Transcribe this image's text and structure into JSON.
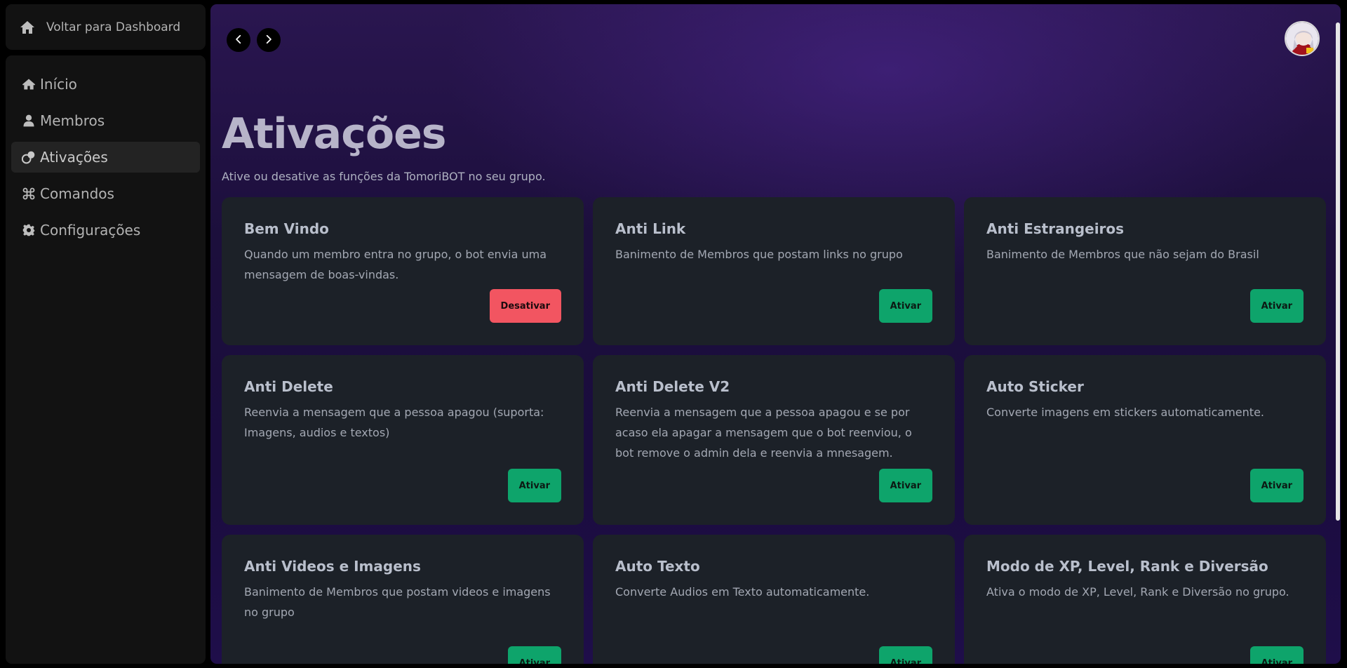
{
  "sidebar": {
    "back_label": "Voltar para Dashboard",
    "items": [
      {
        "label": "Início",
        "icon": "home-icon",
        "active": false
      },
      {
        "label": "Membros",
        "icon": "user-icon",
        "active": false
      },
      {
        "label": "Ativações",
        "icon": "toggle-icon",
        "active": true
      },
      {
        "label": "Comandos",
        "icon": "command-icon",
        "active": false
      },
      {
        "label": "Configurações",
        "icon": "gear-icon",
        "active": false
      }
    ]
  },
  "header": {
    "prev_icon": "chevron-left-icon",
    "next_icon": "chevron-right-icon",
    "avatar_icon": "avatar"
  },
  "page": {
    "title": "Ativações",
    "subtitle": "Ative ou desative as funções da TomoriBOT no seu grupo."
  },
  "cards": [
    {
      "title": "Bem Vindo",
      "description": "Quando um membro entra no grupo, o bot envia uma mensagem de boas-vindas.",
      "button": "Desativar",
      "state": "on"
    },
    {
      "title": "Anti Link",
      "description": "Banimento de Membros que postam links no grupo",
      "button": "Ativar",
      "state": "off"
    },
    {
      "title": "Anti Estrangeiros",
      "description": "Banimento de Membros que não sejam do Brasil",
      "button": "Ativar",
      "state": "off"
    },
    {
      "title": "Anti Delete",
      "description": "Reenvia a mensagem que a pessoa apagou (suporta: Imagens, audios e textos)",
      "button": "Ativar",
      "state": "off"
    },
    {
      "title": "Anti Delete V2",
      "description": "Reenvia a mensagem que a pessoa apagou e se por acaso ela apagar a mensagem que o bot reenviou, o bot remove o admin dela e reenvia a mnesagem.",
      "button": "Ativar",
      "state": "off"
    },
    {
      "title": "Auto Sticker",
      "description": "Converte imagens em stickers automaticamente.",
      "button": "Ativar",
      "state": "off"
    },
    {
      "title": "Anti Videos e Imagens",
      "description": "Banimento de Membros que postam videos e imagens no grupo",
      "button": "Ativar",
      "state": "off"
    },
    {
      "title": "Auto Texto",
      "description": "Converte Audios em Texto automaticamente.",
      "button": "Ativar",
      "state": "off"
    },
    {
      "title": "Modo de XP, Level, Rank e Diversão",
      "description": "Ativa o modo de XP, Level, Rank e Diversão no grupo.",
      "button": "Ativar",
      "state": "off"
    }
  ],
  "colors": {
    "activate_button": "#0ea46b",
    "deactivate_button": "#f25561",
    "card_background": "#1c2128"
  }
}
